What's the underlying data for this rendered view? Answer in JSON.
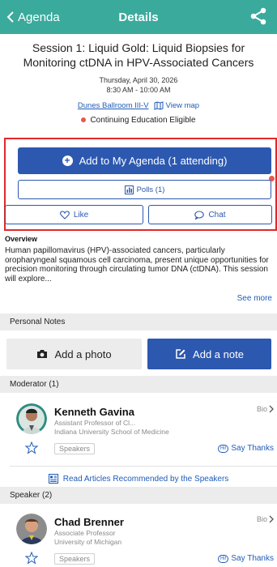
{
  "header": {
    "back_label": "Agenda",
    "title": "Details"
  },
  "session": {
    "title": "Session 1: Liquid Gold: Liquid Biopsies for Monitoring ctDNA in HPV-Associated Cancers",
    "date": "Thursday, April 30, 2026",
    "time": "8:30 AM - 10:00 AM",
    "location": "Dunes Ballroom III-V",
    "view_map": "View map",
    "ce_label": "Continuing Education Eligible"
  },
  "actions": {
    "add_agenda": "Add to My Agenda (1 attending)",
    "polls": "Polls (1)",
    "like": "Like",
    "chat": "Chat"
  },
  "overview": {
    "heading": "Overview",
    "text": "Human papillomavirus (HPV)-associated cancers, particularly oropharyngeal squamous cell carcinoma, present unique opportunities for precision monitoring through circulating tumor DNA (ctDNA). This session will explore...",
    "see_more": "See more"
  },
  "notes": {
    "heading": "Personal Notes",
    "add_photo": "Add a photo",
    "add_note": "Add a note"
  },
  "moderator": {
    "heading": "Moderator (1)",
    "name": "Kenneth Gavina",
    "title": "Assistant Professor of Cl...",
    "org": "Indiana University School of Medicine",
    "bio": "Bio",
    "tag": "Speakers",
    "say_thanks": "Say Thanks",
    "hi": "Hi!"
  },
  "articles_link": "Read Articles Recommended by the Speakers",
  "speaker": {
    "heading": "Speaker (2)",
    "name": "Chad Brenner",
    "title": "Associate Professor",
    "org": "University of Michigan",
    "bio": "Bio",
    "tag": "Speakers",
    "say_thanks": "Say Thanks",
    "hi": "Hi!"
  },
  "colors": {
    "header_teal": "#3aaa9c",
    "primary_blue": "#2d58b0",
    "link_blue": "#1f5cb8",
    "highlight_red": "#e0282a",
    "dot_red": "#e55a4a"
  }
}
